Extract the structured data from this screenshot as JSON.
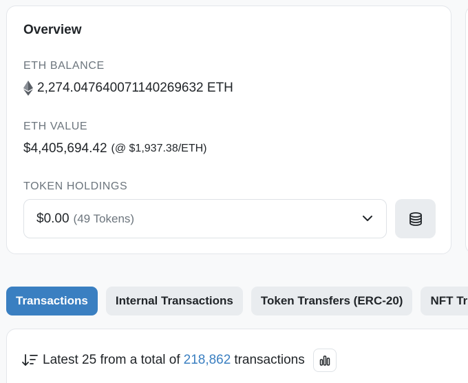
{
  "overview": {
    "title": "Overview",
    "eth_balance_label": "ETH BALANCE",
    "eth_balance_value": "2,274.047640071140269632 ETH",
    "eth_value_label": "ETH VALUE",
    "eth_value_amount": "$4,405,694.42",
    "eth_value_rate": "(@ $1,937.38/ETH)",
    "token_holdings_label": "TOKEN HOLDINGS",
    "token_holdings_value": "$0.00",
    "token_holdings_count": "(49 Tokens)"
  },
  "tabs": [
    {
      "label": "Transactions",
      "active": true
    },
    {
      "label": "Internal Transactions",
      "active": false
    },
    {
      "label": "Token Transfers (ERC-20)",
      "active": false
    },
    {
      "label": "NFT Tr",
      "active": false
    }
  ],
  "transactions": {
    "prefix": "Latest 25 from a total of",
    "total": "218,862",
    "suffix": "transactions"
  },
  "icons": {
    "eth": "ethereum-icon",
    "chevron": "chevron-down-icon",
    "coins": "coins-icon",
    "sort": "sort-descending-icon",
    "chart": "bar-chart-icon"
  },
  "colors": {
    "accent": "#3a7fc1",
    "muted": "#6c757d",
    "tab_bg": "#e9ecef"
  }
}
